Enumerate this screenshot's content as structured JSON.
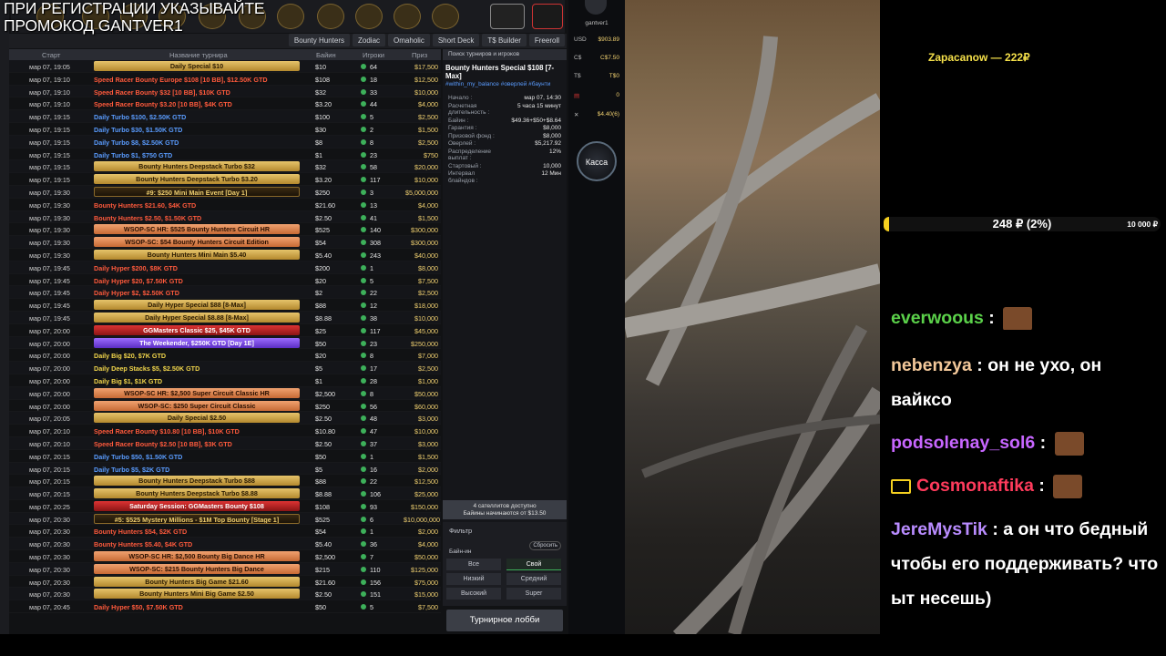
{
  "overlay": {
    "promo_line1": "ПРИ РЕГИСТРАЦИИ УКАЗЫВАЙТЕ",
    "promo_line2": "ПРОМОКОД GANTVER1"
  },
  "tabs": [
    "Bounty Hunters",
    "Zodiac",
    "Omaholic",
    "Short Deck",
    "T$ Builder",
    "Freeroll"
  ],
  "table_header": {
    "start": "Старт",
    "name": "Название турнира",
    "buyin": "Байин",
    "players": "Игроки",
    "prize": "Приз"
  },
  "rows": [
    {
      "start": "мар 07, 19:05",
      "name": "Daily Special $10",
      "style": "gold",
      "buyin": "$10",
      "players": "64",
      "prize": "$17,500"
    },
    {
      "start": "мар 07, 19:10",
      "name": "Speed Racer Bounty Europe $108 [10 BB], $12.50K GTD",
      "style": "red",
      "buyin": "$108",
      "players": "18",
      "prize": "$12,500"
    },
    {
      "start": "мар 07, 19:10",
      "name": "Speed Racer Bounty $32 [10 BB], $10K GTD",
      "style": "red",
      "buyin": "$32",
      "players": "33",
      "prize": "$10,000"
    },
    {
      "start": "мар 07, 19:10",
      "name": "Speed Racer Bounty $3.20 [10 BB], $4K GTD",
      "style": "red",
      "buyin": "$3.20",
      "players": "44",
      "prize": "$4,000"
    },
    {
      "start": "мар 07, 19:15",
      "name": "Daily Turbo $100, $2.50K GTD",
      "style": "blue",
      "buyin": "$100",
      "players": "5",
      "prize": "$2,500"
    },
    {
      "start": "мар 07, 19:15",
      "name": "Daily Turbo $30, $1.50K GTD",
      "style": "blue",
      "buyin": "$30",
      "players": "2",
      "prize": "$1,500"
    },
    {
      "start": "мар 07, 19:15",
      "name": "Daily Turbo $8, $2.50K GTD",
      "style": "blue",
      "buyin": "$8",
      "players": "8",
      "prize": "$2,500"
    },
    {
      "start": "мар 07, 19:15",
      "name": "Daily Turbo $1, $750 GTD",
      "style": "blue",
      "buyin": "$1",
      "players": "23",
      "prize": "$750"
    },
    {
      "start": "мар 07, 19:15",
      "name": "Bounty Hunters Deepstack Turbo $32",
      "style": "gold",
      "buyin": "$32",
      "players": "58",
      "prize": "$20,000"
    },
    {
      "start": "мар 07, 19:15",
      "name": "Bounty Hunters Deepstack Turbo $3.20",
      "style": "gold",
      "buyin": "$3.20",
      "players": "117",
      "prize": "$10,000"
    },
    {
      "start": "мар 07, 19:30",
      "name": "#9: $250 Mini Main Event [Day 1]",
      "style": "dark",
      "buyin": "$250",
      "players": "3",
      "prize": "$5,000,000"
    },
    {
      "start": "мар 07, 19:30",
      "name": "Bounty Hunters $21.60, $4K GTD",
      "style": "red",
      "buyin": "$21.60",
      "players": "13",
      "prize": "$4,000"
    },
    {
      "start": "мар 07, 19:30",
      "name": "Bounty Hunters $2.50, $1.50K GTD",
      "style": "red",
      "buyin": "$2.50",
      "players": "41",
      "prize": "$1,500"
    },
    {
      "start": "мар 07, 19:30",
      "name": "WSOP-SC HR: $525 Bounty Hunters Circuit HR",
      "style": "orange",
      "buyin": "$525",
      "players": "140",
      "prize": "$300,000"
    },
    {
      "start": "мар 07, 19:30",
      "name": "WSOP-SC: $54 Bounty Hunters Circuit Edition",
      "style": "orange",
      "buyin": "$54",
      "players": "308",
      "prize": "$300,000"
    },
    {
      "start": "мар 07, 19:30",
      "name": "Bounty Hunters Mini Main $5.40",
      "style": "gold",
      "buyin": "$5.40",
      "players": "243",
      "prize": "$40,000"
    },
    {
      "start": "мар 07, 19:45",
      "name": "Daily Hyper $200, $8K GTD",
      "style": "red",
      "buyin": "$200",
      "players": "1",
      "prize": "$8,000"
    },
    {
      "start": "мар 07, 19:45",
      "name": "Daily Hyper $20, $7.50K GTD",
      "style": "red",
      "buyin": "$20",
      "players": "5",
      "prize": "$7,500"
    },
    {
      "start": "мар 07, 19:45",
      "name": "Daily Hyper $2, $2.50K GTD",
      "style": "red",
      "buyin": "$2",
      "players": "22",
      "prize": "$2,500"
    },
    {
      "start": "мар 07, 19:45",
      "name": "Daily Hyper Special $88 [8-Max]",
      "style": "gold",
      "buyin": "$88",
      "players": "12",
      "prize": "$18,000"
    },
    {
      "start": "мар 07, 19:45",
      "name": "Daily Hyper Special $8.88 [8-Max]",
      "style": "gold",
      "buyin": "$8.88",
      "players": "38",
      "prize": "$10,000"
    },
    {
      "start": "мар 07, 20:00",
      "name": "GGMasters Classic $25, $45K GTD",
      "style": "redband",
      "buyin": "$25",
      "players": "117",
      "prize": "$45,000"
    },
    {
      "start": "мар 07, 20:00",
      "name": "The Weekender, $250K GTD [Day 1E]",
      "style": "purple",
      "buyin": "$50",
      "players": "23",
      "prize": "$250,000"
    },
    {
      "start": "мар 07, 20:00",
      "name": "Daily Big $20, $7K GTD",
      "style": "yel",
      "buyin": "$20",
      "players": "8",
      "prize": "$7,000"
    },
    {
      "start": "мар 07, 20:00",
      "name": "Daily Deep Stacks $5, $2.50K GTD",
      "style": "yel",
      "buyin": "$5",
      "players": "17",
      "prize": "$2,500"
    },
    {
      "start": "мар 07, 20:00",
      "name": "Daily Big $1, $1K GTD",
      "style": "yel",
      "buyin": "$1",
      "players": "28",
      "prize": "$1,000"
    },
    {
      "start": "мар 07, 20:00",
      "name": "WSOP-SC HR: $2,500 Super Circuit Classic HR",
      "style": "orange",
      "buyin": "$2,500",
      "players": "8",
      "prize": "$50,000"
    },
    {
      "start": "мар 07, 20:00",
      "name": "WSOP-SC: $250 Super Circuit Classic",
      "style": "orange",
      "buyin": "$250",
      "players": "56",
      "prize": "$60,000"
    },
    {
      "start": "мар 07, 20:05",
      "name": "Daily Special $2.50",
      "style": "gold",
      "buyin": "$2.50",
      "players": "48",
      "prize": "$3,000"
    },
    {
      "start": "мар 07, 20:10",
      "name": "Speed Racer Bounty $10.80 [10 BB], $10K GTD",
      "style": "red",
      "buyin": "$10.80",
      "players": "47",
      "prize": "$10,000"
    },
    {
      "start": "мар 07, 20:10",
      "name": "Speed Racer Bounty $2.50 [10 BB], $3K GTD",
      "style": "red",
      "buyin": "$2.50",
      "players": "37",
      "prize": "$3,000"
    },
    {
      "start": "мар 07, 20:15",
      "name": "Daily Turbo $50, $1.50K GTD",
      "style": "blue",
      "buyin": "$50",
      "players": "1",
      "prize": "$1,500"
    },
    {
      "start": "мар 07, 20:15",
      "name": "Daily Turbo $5, $2K GTD",
      "style": "blue",
      "buyin": "$5",
      "players": "16",
      "prize": "$2,000"
    },
    {
      "start": "мар 07, 20:15",
      "name": "Bounty Hunters Deepstack Turbo $88",
      "style": "gold",
      "buyin": "$88",
      "players": "22",
      "prize": "$12,500"
    },
    {
      "start": "мар 07, 20:15",
      "name": "Bounty Hunters Deepstack Turbo $8.88",
      "style": "gold",
      "buyin": "$8.88",
      "players": "106",
      "prize": "$25,000"
    },
    {
      "start": "мар 07, 20:25",
      "name": "Saturday Session: GGMasters Bounty $108",
      "style": "redband",
      "buyin": "$108",
      "players": "93",
      "prize": "$150,000"
    },
    {
      "start": "мар 07, 20:30",
      "name": "#5: $525 Mystery Millions - $1M Top Bounty [Stage 1]",
      "style": "dark",
      "buyin": "$525",
      "players": "6",
      "prize": "$10,000,000"
    },
    {
      "start": "мар 07, 20:30",
      "name": "Bounty Hunters $54, $2K GTD",
      "style": "red",
      "buyin": "$54",
      "players": "1",
      "prize": "$2,000"
    },
    {
      "start": "мар 07, 20:30",
      "name": "Bounty Hunters $5.40, $4K GTD",
      "style": "red",
      "buyin": "$5.40",
      "players": "36",
      "prize": "$4,000"
    },
    {
      "start": "мар 07, 20:30",
      "name": "WSOP-SC HR: $2,500 Bounty Big Dance HR",
      "style": "orange",
      "buyin": "$2,500",
      "players": "7",
      "prize": "$50,000"
    },
    {
      "start": "мар 07, 20:30",
      "name": "WSOP-SC: $215 Bounty Hunters Big Dance",
      "style": "orange",
      "buyin": "$215",
      "players": "110",
      "prize": "$125,000"
    },
    {
      "start": "мар 07, 20:30",
      "name": "Bounty Hunters Big Game $21.60",
      "style": "gold",
      "buyin": "$21.60",
      "players": "156",
      "prize": "$75,000"
    },
    {
      "start": "мар 07, 20:30",
      "name": "Bounty Hunters Mini Big Game $2.50",
      "style": "gold",
      "buyin": "$2.50",
      "players": "151",
      "prize": "$15,000"
    },
    {
      "start": "мар 07, 20:45",
      "name": "Daily Hyper $50, $7.50K GTD",
      "style": "red",
      "buyin": "$50",
      "players": "5",
      "prize": "$7,500"
    }
  ],
  "detail": {
    "search": "Поиск турниров и игроков",
    "title": "Bounty Hunters Special $108 [7-Max]",
    "tags": "#within_my_balance #оверлей #баунти",
    "fields": [
      {
        "k": "Начало :",
        "v": "мар 07, 14:30"
      },
      {
        "k": "Расчетная длительность :",
        "v": "5 часа 15 минут"
      },
      {
        "k": "Байин :",
        "v": "$49.36+$50+$8.64"
      },
      {
        "k": "Гарантия :",
        "v": "$8,000"
      },
      {
        "k": "Призовой фонд :",
        "v": "$8,000"
      },
      {
        "k": "Оверлей :",
        "v": "$5,217.92"
      },
      {
        "k": "Распределение выплат :",
        "v": "12%"
      },
      {
        "k": "Стартовый :",
        "v": "10,000"
      },
      {
        "k": "Интервал блайндов :",
        "v": "12 Мин"
      }
    ],
    "satellites_line1": "4 сателлитов доступно",
    "satellites_line2": "Байины начинаются от $13.50"
  },
  "filter": {
    "title": "Фильтр",
    "reset": "Сбросить",
    "buyin_label": "Байн-ин",
    "buttons": [
      "Все",
      "Свой",
      "Низкий",
      "Средний",
      "Высокий",
      "Super"
    ]
  },
  "lobby_button": "Турнирное лобби",
  "wallet": {
    "user": "gantver1",
    "rows": [
      {
        "c": "USD",
        "v": "$903.89"
      },
      {
        "c": "C$",
        "v": "C$7.50"
      },
      {
        "c": "T$",
        "v": "T$0"
      },
      {
        "c": "",
        "v": "0"
      },
      {
        "c": "",
        "v": "$4.40(6)"
      }
    ],
    "kassa": "Касса"
  },
  "donation": {
    "text": "Zapacanow — 222₽"
  },
  "goal": {
    "current": "248 ₽ (2%)",
    "max": "10 000 ₽",
    "progress": 0.02
  },
  "chat": [
    {
      "user": "everwoous",
      "text": "",
      "color": "#5bd14a",
      "emote": true
    },
    {
      "user": "nebenzya",
      "text": ": он не ухо, он вайксо",
      "color": "#f3c89a",
      "emote": false
    },
    {
      "user": "podsolenay_sol6",
      "text": ":",
      "color": "#c766ff",
      "emote": true
    },
    {
      "user": "Cosmonaftika",
      "text": ":",
      "color": "#ff3b5c",
      "emote": true
    },
    {
      "user": "JereMysTik",
      "text": ": а он что бедный чтобы его поддерживать? что ыт несешь)",
      "color": "#b98cff",
      "emote": false
    }
  ]
}
